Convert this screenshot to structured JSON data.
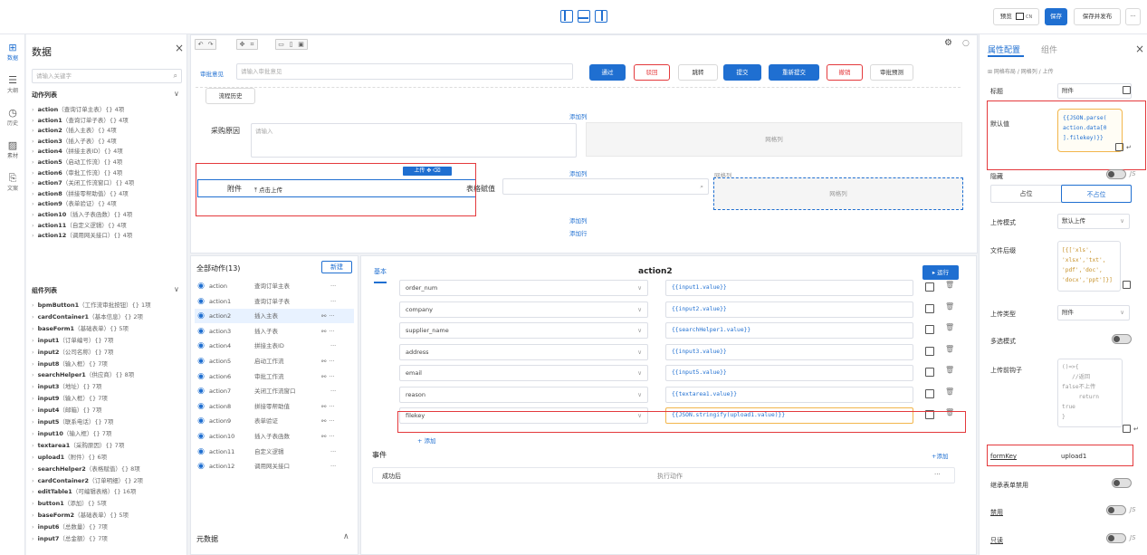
{
  "topbar": {
    "icons": [
      "layout-left-icon",
      "layout-bottom-icon",
      "layout-right-icon"
    ],
    "preview_label": "预览",
    "preview_sub": "CN",
    "save_label": "保存",
    "save_publish_label": "保存并发布",
    "more_label": "···"
  },
  "rail": [
    {
      "label": "数据",
      "icon": "data-icon",
      "active": true
    },
    {
      "label": "大纲",
      "icon": "outline-icon",
      "active": false
    },
    {
      "label": "历史",
      "icon": "history-icon",
      "active": false
    },
    {
      "label": "素材",
      "icon": "material-icon",
      "active": false
    },
    {
      "label": "文案",
      "icon": "copy-icon",
      "active": false
    }
  ],
  "left_panel": {
    "title": "数据",
    "close": "×",
    "search_placeholder": "请输入关键字",
    "actions_section": "动作列表",
    "actions": [
      {
        "name": "action",
        "desc": "（查询订单主表）{} 4项"
      },
      {
        "name": "action1",
        "desc": "（查询订单子表）{} 4项"
      },
      {
        "name": "action2",
        "desc": "（插入主表）{} 4项"
      },
      {
        "name": "action3",
        "desc": "（插入子表）{} 4项"
      },
      {
        "name": "action4",
        "desc": "（拼接主表ID）{} 4项"
      },
      {
        "name": "action5",
        "desc": "（启动工作流）{} 4项"
      },
      {
        "name": "action6",
        "desc": "（审批工作流）{} 4项"
      },
      {
        "name": "action7",
        "desc": "（关闭工作流窗口）{} 4项"
      },
      {
        "name": "action8",
        "desc": "（拼接零帮助值）{} 4项"
      },
      {
        "name": "action9",
        "desc": "（表单验证）{} 4项"
      },
      {
        "name": "action10",
        "desc": "（插入子表函数）{} 4项"
      },
      {
        "name": "action11",
        "desc": "（自定义逻辑）{} 4项"
      },
      {
        "name": "action12",
        "desc": "（调用网关接口）{} 4项"
      }
    ],
    "components_section": "组件列表",
    "components": [
      {
        "name": "bpmButton1",
        "desc": "（工作流审批按钮）{} 1项"
      },
      {
        "name": "cardContainer1",
        "desc": "（基本信息）{} 2项"
      },
      {
        "name": "baseForm1",
        "desc": "（基础表单）{} 5项"
      },
      {
        "name": "input1",
        "desc": "（订单编号）{} 7项"
      },
      {
        "name": "input2",
        "desc": "（公司名称）{} 7项"
      },
      {
        "name": "input8",
        "desc": "（输入框）{} 7项"
      },
      {
        "name": "searchHelper1",
        "desc": "（供应商）{} 8项"
      },
      {
        "name": "input3",
        "desc": "（地址）{} 7项"
      },
      {
        "name": "input9",
        "desc": "（输入框）{} 7项"
      },
      {
        "name": "input4",
        "desc": "（邮箱）{} 7项"
      },
      {
        "name": "input5",
        "desc": "（联系电话）{} 7项"
      },
      {
        "name": "input10",
        "desc": "（输入框）{} 7项"
      },
      {
        "name": "textarea1",
        "desc": "（采购原因）{} 7项"
      },
      {
        "name": "upload1",
        "desc": "（附件）{} 6项"
      },
      {
        "name": "searchHelper2",
        "desc": "（表格赋值）{} 8项"
      },
      {
        "name": "cardContainer2",
        "desc": "（订单明细）{} 2项"
      },
      {
        "name": "editTable1",
        "desc": "（可编辑表格）{} 16项"
      },
      {
        "name": "button1",
        "desc": "（添加）{} 5项"
      },
      {
        "name": "baseForm2",
        "desc": "（基础表单）{} 5项"
      },
      {
        "name": "input6",
        "desc": "（总数量）{} 7项"
      },
      {
        "name": "input7",
        "desc": "（总金额）{} 7项"
      }
    ]
  },
  "canvas": {
    "approval_label": "审批意见",
    "approval_placeholder": "请输入审批意见",
    "pass": "通过",
    "reject": "驳回",
    "jump": "跳转",
    "submit": "提交",
    "resubmit": "重新提交",
    "revoke": "撤销",
    "predict": "审批预测",
    "history": "流程历史",
    "add_col": "添加列",
    "add_row": "添加行",
    "reason_label": "采购原因",
    "reason_placeholder": "请输入",
    "grid_col": "网格列",
    "attach_label": "附件",
    "upload_btn": "点击上传",
    "upload_tag": "上传",
    "table_assign": "表格赋值"
  },
  "actions_panel": {
    "title": "全部动作(13)",
    "new": "新建",
    "meta": "元数据",
    "rows": [
      {
        "name": "action",
        "desc": "查询订单主表",
        "more": "···",
        "link": false
      },
      {
        "name": "action1",
        "desc": "查询订单子表",
        "more": "···",
        "link": false
      },
      {
        "name": "action2",
        "desc": "插入主表",
        "more": "···",
        "link": true,
        "selected": true
      },
      {
        "name": "action3",
        "desc": "插入子表",
        "more": "···",
        "link": true
      },
      {
        "name": "action4",
        "desc": "拼接主表ID",
        "more": "···",
        "link": false
      },
      {
        "name": "action5",
        "desc": "启动工作流",
        "more": "···",
        "link": true
      },
      {
        "name": "action6",
        "desc": "审批工作流",
        "more": "···",
        "link": true
      },
      {
        "name": "action7",
        "desc": "关闭工作流窗口",
        "more": "···",
        "link": false
      },
      {
        "name": "action8",
        "desc": "拼接零帮助值",
        "more": "···",
        "link": true
      },
      {
        "name": "action9",
        "desc": "表单验证",
        "more": "···",
        "link": true
      },
      {
        "name": "action10",
        "desc": "插入子表函数",
        "more": "···",
        "link": true
      },
      {
        "name": "action11",
        "desc": "自定义逻辑",
        "more": "···",
        "link": false
      },
      {
        "name": "action12",
        "desc": "调用网关接口",
        "more": "···",
        "link": false
      }
    ]
  },
  "editor": {
    "tab": "基本",
    "title": "action2",
    "run": "运行",
    "params": [
      {
        "field": "order_num",
        "value": "{{input1.value}}"
      },
      {
        "field": "company",
        "value": "{{input2.value}}"
      },
      {
        "field": "supplier_name",
        "value": "{{searchHelper1.value}}"
      },
      {
        "field": "address",
        "value": "{{input3.value}}"
      },
      {
        "field": "email",
        "value": "{{input5.value}}"
      },
      {
        "field": "reason",
        "value": "{{textarea1.value}}"
      },
      {
        "field": "filekey",
        "value": "{{JSON.stringify(upload1.value)}}"
      }
    ],
    "add": "+ 添加",
    "events": "事件",
    "add_event": "+添加",
    "event_name": "成功后",
    "event_action": "执行动作",
    "event_more": "···"
  },
  "right_panel": {
    "tab_props": "属性配置",
    "tab_comp": "组件",
    "close": "×",
    "breadcrumb": "⊞ 网格布局 / 网格列 / 上传",
    "title_label": "标题",
    "title_value": "附件",
    "default_label": "默认值",
    "default_code": "{{JSON.parse(\naction.data[0\n].filekey)}}",
    "hidden_label": "隐藏",
    "occupy": "占位",
    "no_occupy": "不占位",
    "upload_mode_label": "上传模式",
    "upload_mode_value": "默认上传",
    "file_suffix_label": "文件后缀",
    "file_suffix_code": "[{['xls',\n'xlsx','txt',\n'pdf','doc',\n'docx','ppt']}]",
    "upload_type_label": "上传类型",
    "upload_type_value": "附件",
    "multi_label": "多选模式",
    "hook_label": "上传前钩子",
    "hook_code": "()=>{\n   //返回\nfalse不上传\n     return\ntrue\n}",
    "formkey_label": "formKey",
    "formkey_value": "upload1",
    "inherit_label": "继承表单禁用",
    "disabled_label": "禁用",
    "readonly_label": "只读",
    "js": "JS"
  }
}
